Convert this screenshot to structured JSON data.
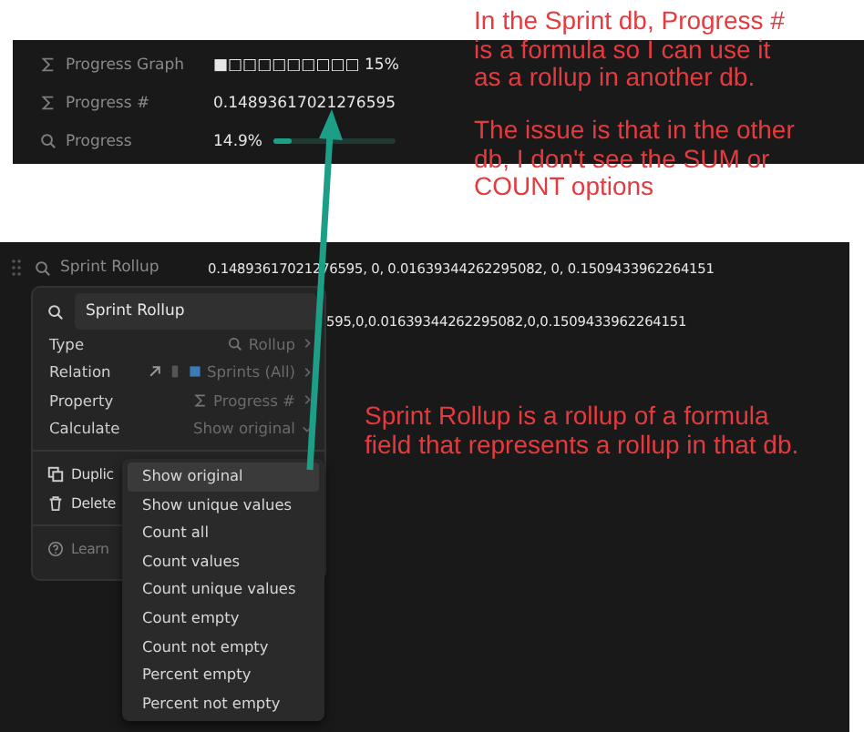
{
  "sprint_db": {
    "properties": [
      {
        "kind": "graph",
        "name": "Progress Graph",
        "value": "■□□□□□□□□□ 15%"
      },
      {
        "kind": "number",
        "name": "Progress #",
        "value": "0.14893617021276595"
      },
      {
        "kind": "bar",
        "name": "Progress",
        "value": "14.9%",
        "level": 0.149
      }
    ]
  },
  "annotations": [
    {
      "text": "In the Sprint db, Progress # is a formula so I can use it as a rollup in another db."
    },
    {
      "text": "The issue is that in the other db, I don't see the SUM or COUNT options"
    },
    {
      "text": "Sprint Rollup is a rollup of a formula field that represents a rollup in that db."
    }
  ],
  "other_db": {
    "property": {
      "name": "Sprint Rollup",
      "value_lines": [
        "0.14893617021276595, 0, 0.01639344262295082, 0, 0.1509433962264151",
        "595,0,0.01639344262295082,0,0.1509433962264151"
      ]
    }
  },
  "property_menu": {
    "name": "Sprint Rollup",
    "settings": [
      {
        "kind": "type",
        "label": "Type",
        "value": "Rollup"
      },
      {
        "kind": "relation",
        "label": "Relation",
        "value": "Sprints (All)"
      },
      {
        "kind": "property",
        "label": "Property",
        "value": "Progress #"
      },
      {
        "kind": "calculate",
        "label": "Calculate",
        "value": "Show original"
      }
    ],
    "actions": [
      {
        "kind": "duplicate",
        "label": "Duplic"
      },
      {
        "kind": "delete",
        "label": "Delete"
      }
    ],
    "help": "Learn"
  },
  "calculate_menu": {
    "options": [
      {
        "label": "Show original",
        "selected": true
      },
      {
        "label": "Show unique values",
        "selected": false
      },
      {
        "label": "Count all",
        "selected": false
      },
      {
        "label": "Count values",
        "selected": false
      },
      {
        "label": "Count unique values",
        "selected": false
      },
      {
        "label": "Count empty",
        "selected": false
      },
      {
        "label": "Count not empty",
        "selected": false
      },
      {
        "label": "Percent empty",
        "selected": false
      },
      {
        "label": "Percent not empty",
        "selected": false
      }
    ]
  }
}
